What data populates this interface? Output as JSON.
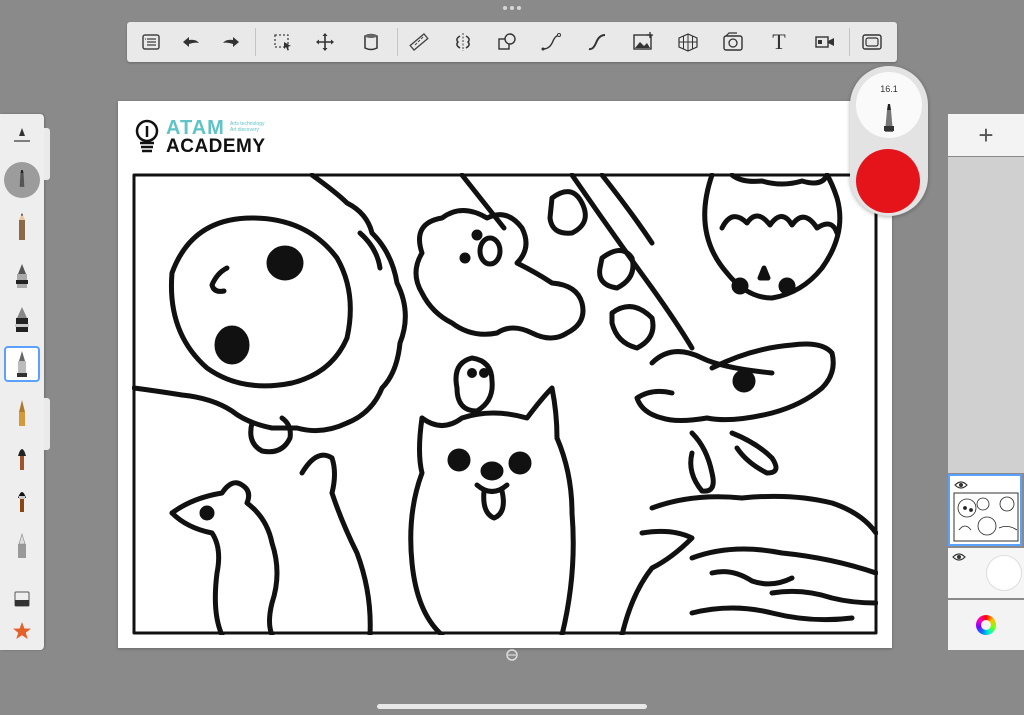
{
  "app": {
    "colors": {
      "background": "#8a8a8a",
      "toolbar": "#e9e9e9",
      "accent": "#5aa0ff",
      "brush_color": "#e5141b",
      "logo_teal": "#5fc3c7"
    }
  },
  "toolbar": {
    "items": [
      {
        "name": "list-icon"
      },
      {
        "name": "undo-icon"
      },
      {
        "name": "redo-icon"
      },
      {
        "name": "selection-icon"
      },
      {
        "name": "transform-icon"
      },
      {
        "name": "fill-icon"
      },
      {
        "name": "ruler-icon"
      },
      {
        "name": "symmetry-icon"
      },
      {
        "name": "shapes-icon"
      },
      {
        "name": "curve-icon"
      },
      {
        "name": "stroke-icon"
      },
      {
        "name": "image-icon"
      },
      {
        "name": "perspective-icon"
      },
      {
        "name": "time-lapse-icon"
      },
      {
        "name": "text-icon",
        "label": "T"
      },
      {
        "name": "video-icon"
      },
      {
        "name": "fullscreen-icon"
      }
    ]
  },
  "brush_puck": {
    "size": "16.1"
  },
  "canvas": {
    "logo": {
      "line1": "ATAM",
      "line2": "ACADEMY",
      "tag1": "Arts technology",
      "tag2": "Art discovery"
    }
  }
}
